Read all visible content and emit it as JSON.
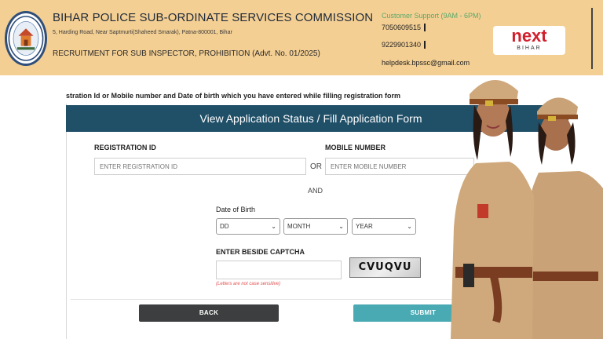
{
  "header": {
    "title": "BIHAR POLICE SUB-ORDINATE SERVICES COMMISSION",
    "address": "5, Harding Road, Near Saptmurti(Shaheed Smarak), Patna-800001, Bihar",
    "recruitment": "RECRUITMENT FOR SUB INSPECTOR, PROHIBITION (Advt. No. 01/2025)",
    "logo_text": "BPSSC",
    "support": {
      "title": "Customer Support (9AM - 6PM)",
      "phone1": "7050609515",
      "phone2": "9229901340",
      "email": "helpdesk.bpssc@gmail.com"
    },
    "brand": {
      "main": "next",
      "sub": "BIHAR",
      "color": "#d21f2d"
    }
  },
  "instruction": "stration Id or Mobile number and Date of birth which you have entered while filling registration form",
  "panel": {
    "title": "View Application Status / Fill Application Form",
    "header_color": "#204f68"
  },
  "form": {
    "registration_label": "REGISTRATION ID",
    "registration_placeholder": "ENTER REGISTRATION ID",
    "or_text": "OR",
    "mobile_label": "MOBILE NUMBER",
    "mobile_placeholder": "ENTER MOBILE NUMBER",
    "and_text": "AND",
    "dob_label": "Date of Birth",
    "dob_day": "DD",
    "dob_month": "MONTH",
    "dob_year": "YEAR",
    "captcha_label": "ENTER BESIDE CAPTCHA",
    "captcha_code": "CVUQVU",
    "captcha_note": "(Letters are not case sensitive)",
    "back_label": "BACK",
    "submit_label": "SUBMIT"
  },
  "colors": {
    "header_bg": "#f4cf93",
    "back_button": "#3d3e3f",
    "submit_button": "#4aaab3",
    "support_title": "#5aa86a"
  },
  "icons": {
    "dropdown": "chevron-down-icon",
    "logo": "bpssc-emblem"
  }
}
